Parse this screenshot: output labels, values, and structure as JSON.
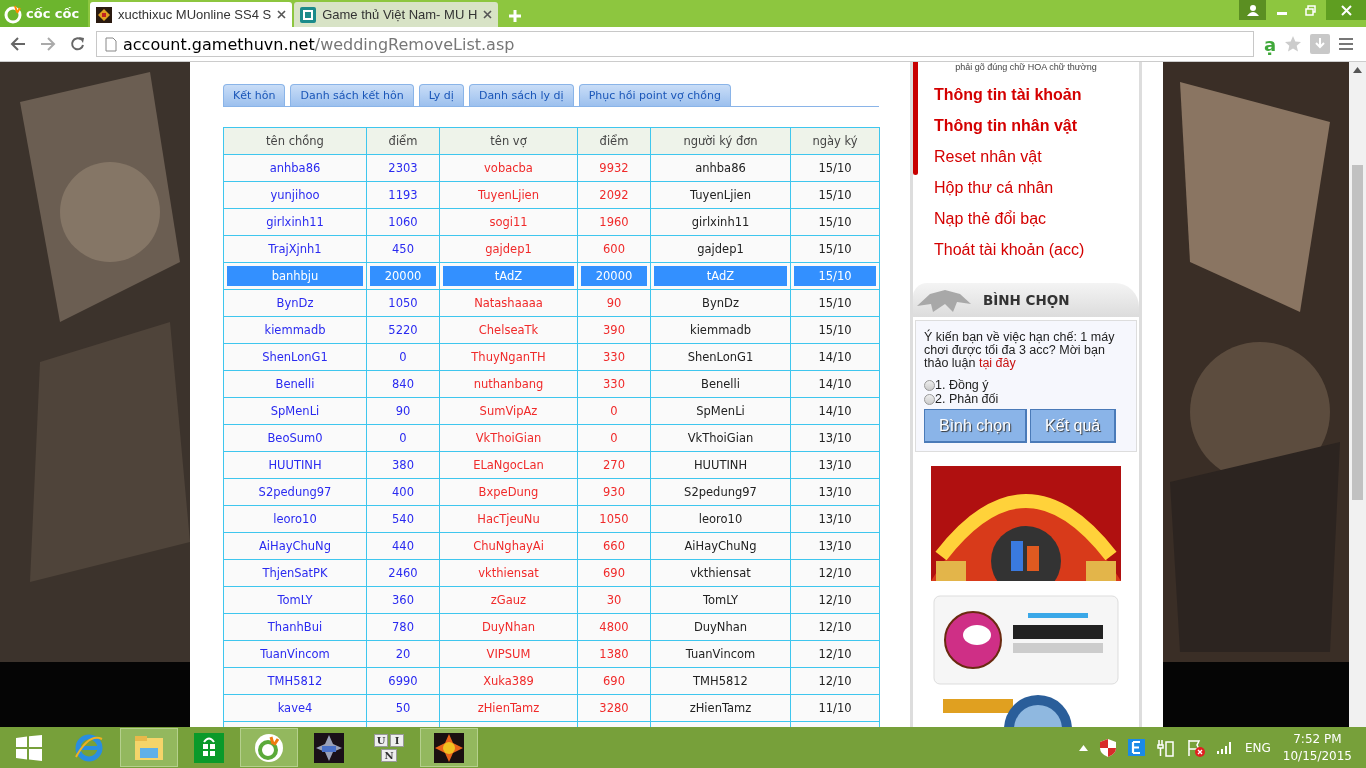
{
  "browser": {
    "logo": "cốc cốc",
    "tabs": [
      {
        "title": "xucthixuc MUonline SS4 S",
        "selected": true
      },
      {
        "title": "Game thủ Việt Nam- MU H",
        "selected": false
      }
    ],
    "address": {
      "domain": "account.gamethuvn.net",
      "path": "/weddingRemoveList.asp"
    },
    "extension_glyph": "ạ"
  },
  "page": {
    "nav_tabs": [
      "Kết hôn",
      "Danh sách kết hôn",
      "Ly dị",
      "Danh sách ly dị",
      "Phục hồi point vợ chồng"
    ],
    "table": {
      "columns": [
        "tên chồng",
        "điểm",
        "tên vợ",
        "điểm",
        "người ký đơn",
        "ngày ký"
      ],
      "rows": [
        {
          "cells": [
            "anhba86",
            "2303",
            "vobacba",
            "9932",
            "anhba86",
            "15/10"
          ],
          "selected": false
        },
        {
          "cells": [
            "yunjihoo",
            "1193",
            "TuyenLjien",
            "2092",
            "TuyenLjien",
            "15/10"
          ],
          "selected": false
        },
        {
          "cells": [
            "girlxinh11",
            "1060",
            "sogi11",
            "1960",
            "girlxinh11",
            "15/10"
          ],
          "selected": false
        },
        {
          "cells": [
            "TrajXjnh1",
            "450",
            "gajdep1",
            "600",
            "gajdep1",
            "15/10"
          ],
          "selected": false
        },
        {
          "cells": [
            "banhbju",
            "20000",
            "tAdZ",
            "20000",
            "tAdZ",
            "15/10"
          ],
          "selected": true
        },
        {
          "cells": [
            "BynDz",
            "1050",
            "Natashaaaa",
            "90",
            "BynDz",
            "15/10"
          ],
          "selected": false
        },
        {
          "cells": [
            "kiemmadb",
            "5220",
            "ChelseaTk",
            "390",
            "kiemmadb",
            "15/10"
          ],
          "selected": false
        },
        {
          "cells": [
            "ShenLonG1",
            "0",
            "ThuyNganTH",
            "330",
            "ShenLonG1",
            "14/10"
          ],
          "selected": false
        },
        {
          "cells": [
            "Benelli",
            "840",
            "nuthanbang",
            "330",
            "Benelli",
            "14/10"
          ],
          "selected": false
        },
        {
          "cells": [
            "SpMenLi",
            "90",
            "SumVipAz",
            "0",
            "SpMenLi",
            "14/10"
          ],
          "selected": false
        },
        {
          "cells": [
            "BeoSum0",
            "0",
            "VkThoiGian",
            "0",
            "VkThoiGian",
            "13/10"
          ],
          "selected": false
        },
        {
          "cells": [
            "HUUTINH",
            "380",
            "ELaNgocLan",
            "270",
            "HUUTINH",
            "13/10"
          ],
          "selected": false
        },
        {
          "cells": [
            "S2pedung97",
            "400",
            "BxpeDung",
            "930",
            "S2pedung97",
            "13/10"
          ],
          "selected": false
        },
        {
          "cells": [
            "leoro10",
            "540",
            "HacTjeuNu",
            "1050",
            "leoro10",
            "13/10"
          ],
          "selected": false
        },
        {
          "cells": [
            "AiHayChuNg",
            "440",
            "ChuNghayAi",
            "660",
            "AiHayChuNg",
            "13/10"
          ],
          "selected": false
        },
        {
          "cells": [
            "ThjenSatPK",
            "2460",
            "vkthiensat",
            "690",
            "vkthiensat",
            "12/10"
          ],
          "selected": false
        },
        {
          "cells": [
            "TomLY",
            "360",
            "zGauz",
            "30",
            "TomLY",
            "12/10"
          ],
          "selected": false
        },
        {
          "cells": [
            "ThanhBui",
            "780",
            "DuyNhan",
            "4800",
            "DuyNhan",
            "12/10"
          ],
          "selected": false
        },
        {
          "cells": [
            "TuanVincom",
            "20",
            "VIPSUM",
            "1380",
            "TuanVincom",
            "12/10"
          ],
          "selected": false
        },
        {
          "cells": [
            "TMH5812",
            "6990",
            "Xuka389",
            "690",
            "TMH5812",
            "12/10"
          ],
          "selected": false
        },
        {
          "cells": [
            "kave4",
            "50",
            "zHienTamz",
            "3280",
            "zHienTamz",
            "11/10"
          ],
          "selected": false
        }
      ]
    }
  },
  "sidebar": {
    "note": "phải gõ đúng chữ HOA chữ thường",
    "menu": [
      {
        "label": "Thông tin tài khoản",
        "emphasized": true
      },
      {
        "label": "Thông tin nhân vật",
        "emphasized": true
      },
      {
        "label": "Reset nhân vật",
        "emphasized": false
      },
      {
        "label": "Hộp thư cá nhân",
        "emphasized": false
      },
      {
        "label": "Nạp thẻ đổi bạc",
        "emphasized": false
      },
      {
        "label": "Thoát tài khoản (acc)",
        "emphasized": false
      }
    ],
    "poll": {
      "title": "BÌNH CHỌN",
      "question": "Ý kiến bạn về việc hạn chế: 1 máy chơi được tối đa 3 acc? Mời bạn thảo luận",
      "link": "tại đây",
      "options": [
        {
          "label": "1. Đồng ý",
          "selected": false
        },
        {
          "label": "2. Phản đối",
          "selected": false
        }
      ],
      "buttons": [
        "Bình chọn",
        "Kết quả"
      ]
    },
    "banners": [
      {
        "kind": "casino"
      },
      {
        "kind": "chat"
      },
      {
        "kind": "seal"
      }
    ]
  },
  "taskbar": {
    "apps": [
      {
        "kind": "browser-e",
        "active": false
      },
      {
        "kind": "folder",
        "active": true
      },
      {
        "kind": "store",
        "active": false
      },
      {
        "kind": "coccoc",
        "active": true
      },
      {
        "kind": "game-mu",
        "active": false
      },
      {
        "kind": "keys",
        "active": false
      },
      {
        "kind": "game-star",
        "active": true
      }
    ],
    "keys": [
      "U",
      "I",
      "N"
    ],
    "language": "ENG",
    "time": "7:52 PM",
    "date": "10/15/2015"
  }
}
